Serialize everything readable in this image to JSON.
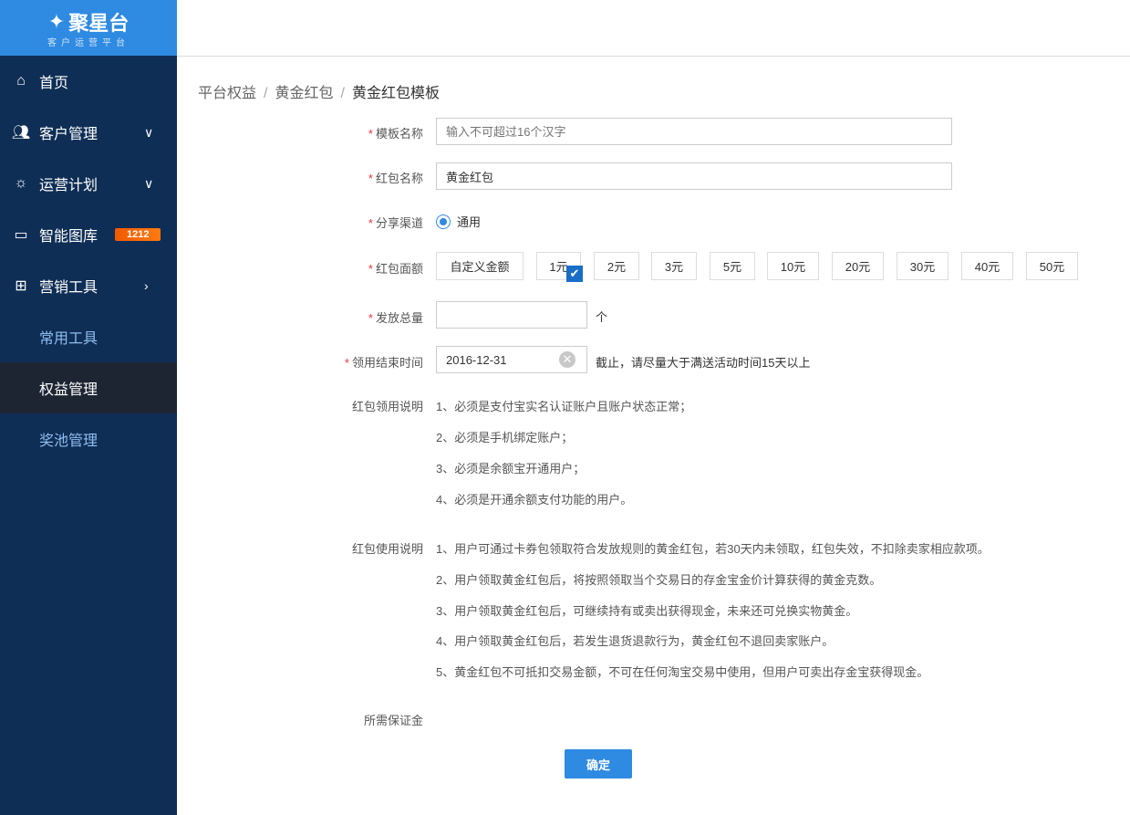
{
  "logo": {
    "title": "聚星台",
    "subtitle": "客户运营平台"
  },
  "sidebar": {
    "items": [
      {
        "label": "首页"
      },
      {
        "label": "客户管理"
      },
      {
        "label": "运营计划"
      },
      {
        "label": "智能图库",
        "badge": "1212"
      },
      {
        "label": "营销工具"
      }
    ],
    "sub_items": [
      {
        "label": "常用工具"
      },
      {
        "label": "权益管理"
      },
      {
        "label": "奖池管理"
      }
    ]
  },
  "breadcrumb": [
    "平台权益",
    "黄金红包",
    "黄金红包模板"
  ],
  "form": {
    "template_name": {
      "label": "模板名称",
      "placeholder": "输入不可超过16个汉字"
    },
    "packet_name": {
      "label": "红包名称",
      "value": "黄金红包"
    },
    "channel": {
      "label": "分享渠道",
      "option": "通用"
    },
    "amount": {
      "label": "红包面额",
      "options": [
        "自定义金额",
        "1元",
        "2元",
        "3元",
        "5元",
        "10元",
        "20元",
        "30元",
        "40元",
        "50元"
      ],
      "selected": "1元"
    },
    "total": {
      "label": "发放总量",
      "value": "",
      "unit": "个"
    },
    "end_time": {
      "label": "领用结束时间",
      "value": "2016-12-31",
      "hint": "截止，请尽量大于满送活动时间15天以上"
    },
    "claim_notes": {
      "label": "红包领用说明",
      "lines": [
        "1、必须是支付宝实名认证账户且账户状态正常；",
        "2、必须是手机绑定账户；",
        "3、必须是余额宝开通用户；",
        "4、必须是开通余额支付功能的用户。"
      ]
    },
    "usage_notes": {
      "label": "红包使用说明",
      "lines": [
        "1、用户可通过卡券包领取符合发放规则的黄金红包，若30天内未领取，红包失效，不扣除卖家相应款项。",
        "2、用户领取黄金红包后，将按照领取当个交易日的存金宝金价计算获得的黄金克数。",
        "3、用户领取黄金红包后，可继续持有或卖出获得现金，未来还可兑换实物黄金。",
        "4、用户领取黄金红包后，若发生退货退款行为，黄金红包不退回卖家账户。",
        "5、黄金红包不可抵扣交易金额，不可在任何淘宝交易中使用，但用户可卖出存金宝获得现金。"
      ]
    },
    "deposit": {
      "label": "所需保证金"
    },
    "submit": "确定"
  },
  "colors": {
    "primary": "#2f8ae1",
    "sidebar": "#0f2e55",
    "required": "#e33333"
  }
}
